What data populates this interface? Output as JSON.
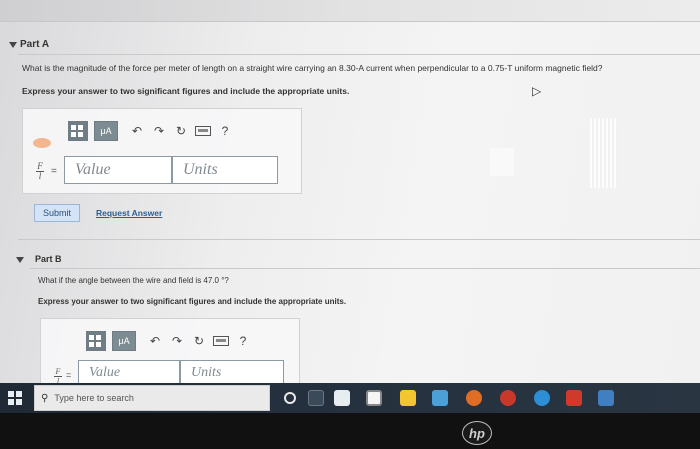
{
  "part_a": {
    "title": "Part A",
    "question": "What is the magnitude of the force per meter of length on a straight wire carrying an 8.30-A current when perpendicular to a 0.75-T uniform magnetic field?",
    "instruction": "Express your answer to two significant figures and include the appropriate units.",
    "toolbar": {
      "unit_button": "μA",
      "help": "?"
    },
    "fraction_num": "F",
    "fraction_den": "l",
    "equals": "=",
    "value_placeholder": "Value",
    "units_placeholder": "Units",
    "submit_label": "Submit",
    "request_answer_label": "Request Answer"
  },
  "part_b": {
    "title": "Part B",
    "question": "What if the angle between the wire and field is 47.0 °?",
    "instruction": "Express your answer to two significant figures and include the appropriate units.",
    "toolbar": {
      "unit_button": "μA",
      "help": "?"
    },
    "fraction_num": "F",
    "fraction_den": "l",
    "equals": "=",
    "value_placeholder": "Value",
    "units_placeholder": "Units"
  },
  "taskbar": {
    "search_placeholder": "Type here to search"
  },
  "laptop": {
    "brand": "hp"
  }
}
